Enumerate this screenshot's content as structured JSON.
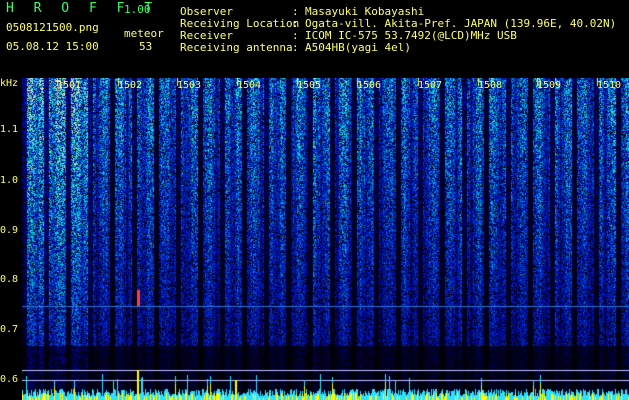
{
  "header": {
    "app_title": "H R O F F T",
    "app_version": "1.00",
    "filename": "0508121500.png",
    "datetime": "05.08.12 15:00",
    "meteor_label": "meteor",
    "meteor_count": "53"
  },
  "info": {
    "rows": [
      {
        "label": "Observer",
        "sep": ":",
        "value": "Masayuki Kobayashi"
      },
      {
        "label": "Receiving Location",
        "sep": ":",
        "value": "Ogata-vill. Akita-Pref. JAPAN (139.96E, 40.02N)"
      },
      {
        "label": "Receiver",
        "sep": ":",
        "value": "ICOM IC-575 53.7492(@LCD)MHz USB"
      },
      {
        "label": "Receiving antenna",
        "sep": ":",
        "value": "A504HB(yagi 4el)"
      }
    ]
  },
  "axis": {
    "unit": "kHz",
    "y_ticks": [
      "1.1",
      "1.0",
      "0.9",
      "0.8",
      "0.7",
      "0.6"
    ],
    "x_ticks": [
      "1501",
      "1502",
      "1503",
      "1504",
      "1505",
      "1506",
      "1507",
      "1508",
      "1509",
      "1510"
    ]
  },
  "colors": {
    "text_yellow": "#ffff66",
    "title_green": "#33ff66",
    "signal_blue": "#1030a0",
    "signal_cyan": "#30e0ff",
    "meteor_red": "#ff4040",
    "histogram_yellow": "#ffff00"
  }
}
